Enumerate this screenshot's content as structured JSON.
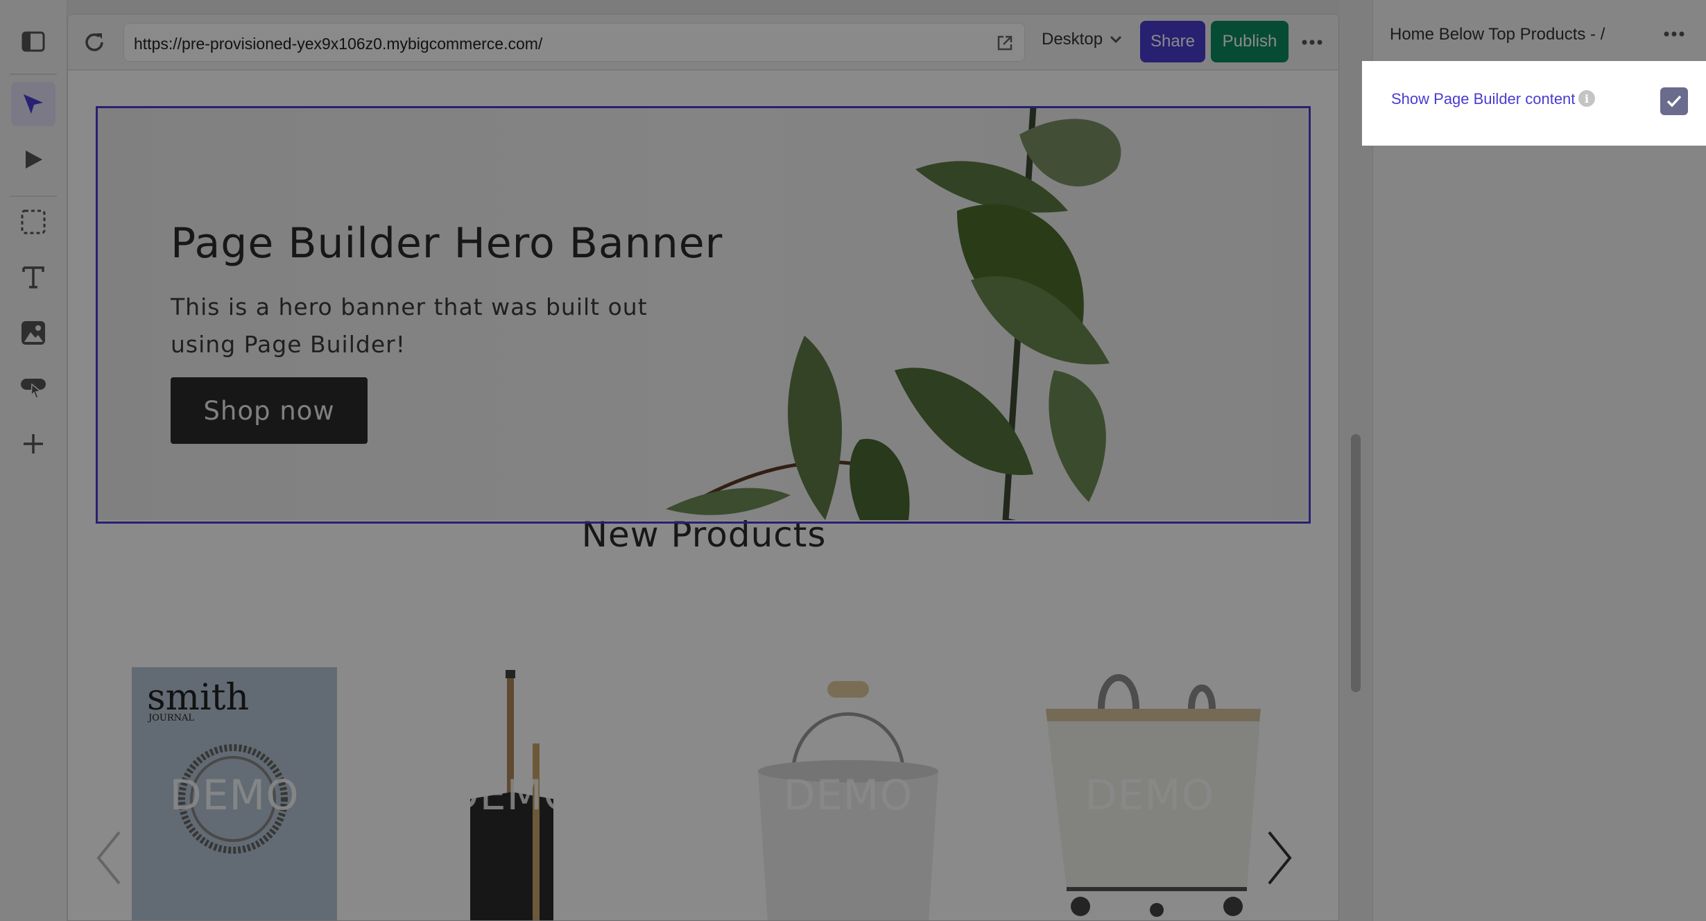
{
  "toolbar": {
    "tools": [
      "panel-toggle-icon",
      "select-icon",
      "preview-icon",
      "region-select-icon",
      "text-icon",
      "image-icon",
      "widget-icon",
      "add-icon"
    ]
  },
  "browser": {
    "url": "https://pre-provisioned-yex9x106z0.mybigcommerce.com/",
    "device": "Desktop",
    "share_label": "Share",
    "publish_label": "Publish"
  },
  "canvas": {
    "hero": {
      "title": "Page Builder Hero Banner",
      "text": "This is a hero banner that was built out using Page Builder!",
      "button_label": "Shop now"
    },
    "section_title": "New Products",
    "products": [
      {
        "watermark": "DEMO",
        "icon": "magazine-image",
        "cover_title": "smith",
        "cover_subtitle": "JOURNAL"
      },
      {
        "watermark": "DEMO",
        "icon": "dustpan-image"
      },
      {
        "watermark": "DEMO",
        "icon": "bucket-image"
      },
      {
        "watermark": "DEMO",
        "icon": "laundry-cart-image"
      }
    ]
  },
  "panel": {
    "title": "Home Below Top Products - /",
    "show_page_builder_label": "Show Page Builder content",
    "show_page_builder_checked": true
  },
  "colors": {
    "accent": "#4a3bd1",
    "publish": "#0c8b5f"
  }
}
